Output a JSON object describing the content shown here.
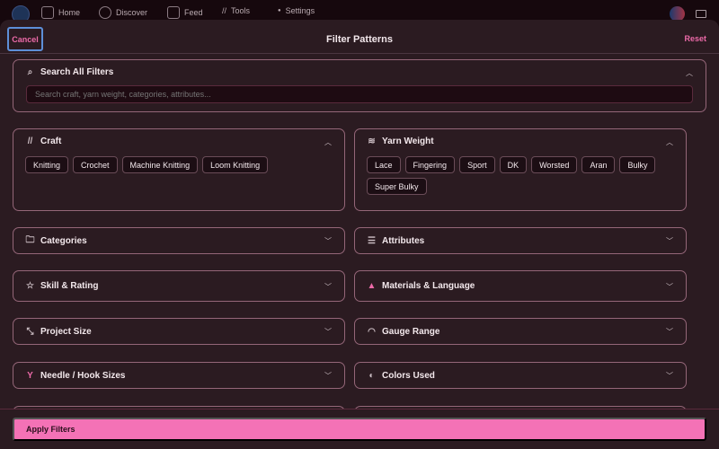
{
  "nav": {
    "items": [
      {
        "label": "Home",
        "icon": "home-icon"
      },
      {
        "label": "Discover",
        "icon": "compass-icon"
      },
      {
        "label": "Feed",
        "icon": "feed-icon"
      },
      {
        "label": "Tools",
        "icon": "tools-icon"
      },
      {
        "label": "Settings",
        "icon": "gear-icon"
      }
    ]
  },
  "header": {
    "cancel": "Cancel",
    "title": "Filter Patterns",
    "reset": "Reset"
  },
  "search": {
    "title": "Search All Filters",
    "placeholder": "Search craft, yarn weight, categories, attributes..."
  },
  "craft": {
    "title": "Craft",
    "chips": [
      "Knitting",
      "Crochet",
      "Machine Knitting",
      "Loom Knitting"
    ]
  },
  "yarn": {
    "title": "Yarn Weight",
    "chips": [
      "Lace",
      "Fingering",
      "Sport",
      "DK",
      "Worsted",
      "Aran",
      "Bulky",
      "Super Bulky"
    ]
  },
  "sections": [
    {
      "title": "Categories",
      "icon": "🗀"
    },
    {
      "title": "Attributes",
      "icon": "☰"
    },
    {
      "title": "Skill & Rating",
      "icon": "☆"
    },
    {
      "title": "Materials & Language",
      "icon": "▲"
    },
    {
      "title": "Project Size",
      "icon": "⤡"
    },
    {
      "title": "Gauge Range",
      "icon": "◠"
    },
    {
      "title": "Needle / Hook Sizes",
      "icon": "Y"
    },
    {
      "title": "Colors Used",
      "icon": "◐"
    }
  ],
  "footer": {
    "apply": "Apply Filters"
  },
  "colors": {
    "accent": "#f472b6",
    "border": "#946678"
  }
}
